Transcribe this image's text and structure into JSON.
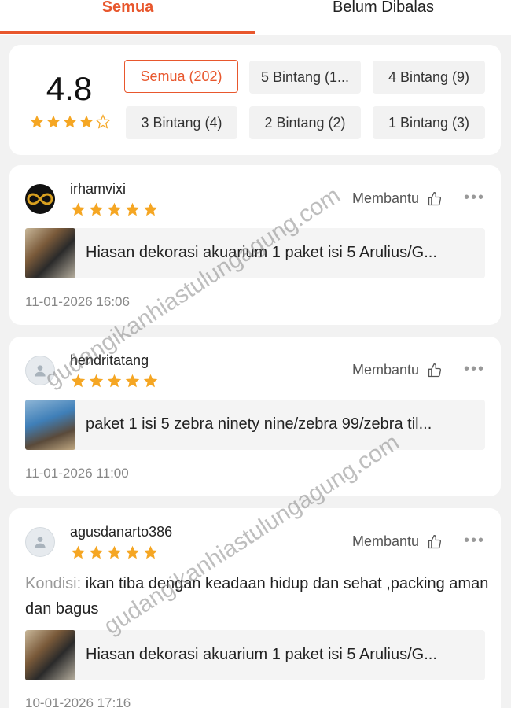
{
  "tabs": [
    {
      "label": "Semua",
      "active": true
    },
    {
      "label": "Belum Dibalas",
      "active": false
    }
  ],
  "summary": {
    "rating": "4.8",
    "stars_filled": 4,
    "filters": [
      {
        "label": "Semua (202)",
        "active": true
      },
      {
        "label": "5 Bintang (1...",
        "active": false
      },
      {
        "label": "4 Bintang (9)",
        "active": false
      },
      {
        "label": "3 Bintang (4)",
        "active": false
      },
      {
        "label": "2 Bintang (2)",
        "active": false
      },
      {
        "label": "1 Bintang (3)",
        "active": false
      }
    ]
  },
  "reviews": [
    {
      "username": "irhamvixi",
      "stars": 5,
      "helpful_label": "Membantu",
      "product_title": "Hiasan dekorasi akuarium 1 paket isi 5 Arulius/G...",
      "date": "11-01-2026 16:06"
    },
    {
      "username": "hendritatang",
      "stars": 5,
      "helpful_label": "Membantu",
      "product_title": "paket 1 isi 5 zebra ninety nine/zebra 99/zebra til...",
      "date": "11-01-2026 11:00"
    },
    {
      "username": "agusdanarto386",
      "stars": 5,
      "helpful_label": "Membantu",
      "comment_label": "Kondisi:",
      "comment_text": " ikan tiba dengan keadaan hidup dan sehat ,packing aman dan bagus",
      "product_title": "Hiasan dekorasi akuarium 1 paket isi 5 Arulius/G...",
      "date": "10-01-2026 17:16"
    }
  ],
  "watermark": "gudangikanhiastulungagung.com",
  "colors": {
    "accent": "#e8572d",
    "star": "#f5a623"
  }
}
